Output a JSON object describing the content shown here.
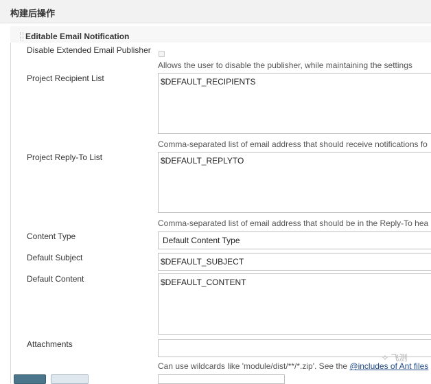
{
  "section": {
    "title": "构建后操作"
  },
  "panel": {
    "title": "Editable Email Notification",
    "disable": {
      "label": "Disable Extended Email Publisher",
      "help": "Allows the user to disable the publisher, while maintaining the settings"
    },
    "recipients": {
      "label": "Project Recipient List",
      "value": "$DEFAULT_RECIPIENTS",
      "help": "Comma-separated list of email address that should receive notifications fo"
    },
    "reply_to": {
      "label": "Project Reply-To List",
      "value": "$DEFAULT_REPLYTO",
      "help": "Comma-separated list of email address that should be in the Reply-To hea"
    },
    "content_type": {
      "label": "Content Type",
      "value": "Default Content Type"
    },
    "subject": {
      "label": "Default Subject",
      "value": "$DEFAULT_SUBJECT"
    },
    "content": {
      "label": "Default Content",
      "value": "$DEFAULT_CONTENT"
    },
    "attachments": {
      "label": "Attachments",
      "value": "",
      "help_prefix": "Can use wildcards like 'module/dist/**/*.zip'. See the ",
      "help_link": "@includes of Ant files"
    }
  },
  "watermark": "飞测"
}
